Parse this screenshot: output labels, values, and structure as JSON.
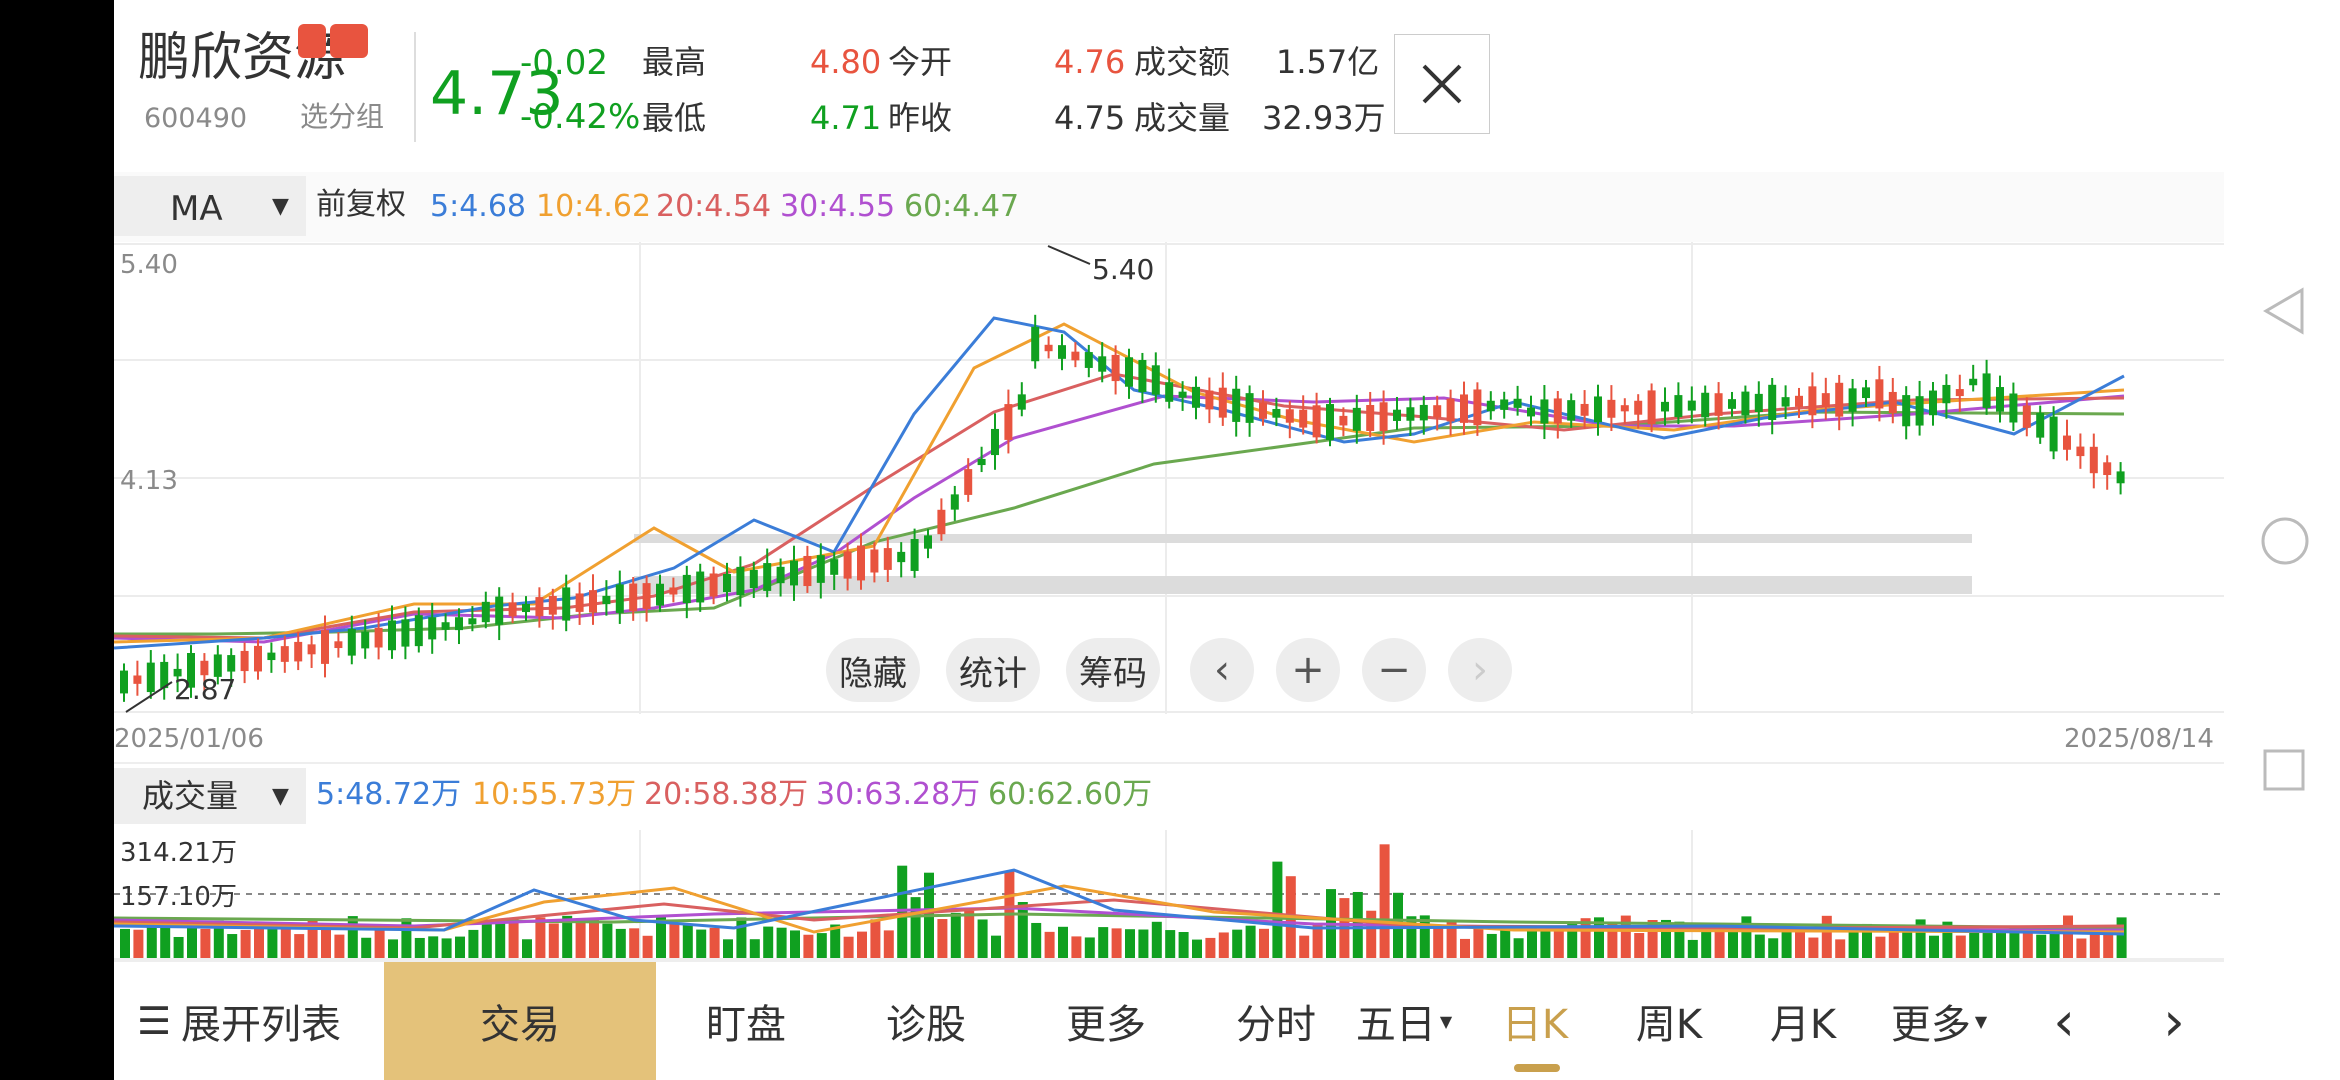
{
  "stock": {
    "name": "鹏欣资源",
    "code": "600490",
    "group": "选分组",
    "price": "4.73",
    "change": "-0.02",
    "change_pct": "-0.42%"
  },
  "quote": {
    "high_label": "最高",
    "high_value": "4.80",
    "low_label": "最低",
    "low_value": "4.71",
    "open_label": "今开",
    "open_value": "4.76",
    "prev_label": "昨收",
    "prev_value": "4.75",
    "amount_label": "成交额",
    "amount_value": "1.57亿",
    "volume_label": "成交量",
    "volume_value": "32.93万"
  },
  "ma_bar": {
    "selector": "MA",
    "adjust": "前复权",
    "ma5": "5:4.68",
    "ma10": "10:4.62",
    "ma20": "20:4.54",
    "ma30": "30:4.55",
    "ma60": "60:4.47"
  },
  "price_axis": {
    "top": "5.40",
    "mid": "4.13"
  },
  "annotations": {
    "high": "5.40",
    "low": "2.87"
  },
  "dates": {
    "start": "2025/01/06",
    "end": "2025/08/14"
  },
  "chart_buttons": {
    "hide": "隐藏",
    "stats": "统计",
    "chips": "筹码",
    "prev": "‹",
    "zoom_in": "+",
    "zoom_out": "−",
    "next": "›"
  },
  "volume_bar": {
    "selector": "成交量",
    "ma5": "5:48.72万",
    "ma10": "10:55.73万",
    "ma20": "20:58.38万",
    "ma30": "30:63.28万",
    "ma60": "60:62.60万",
    "axis_top": "314.21万",
    "axis_mid": "157.10万"
  },
  "bottom_tabs": {
    "expand": "展开列表",
    "trade": "交易",
    "watch": "盯盘",
    "diagnose": "诊股",
    "more": "更多",
    "intraday": "分时",
    "five_day": "五日",
    "daily": "日K",
    "weekly": "周K",
    "monthly": "月K",
    "more2": "更多",
    "left": "‹",
    "right": "›"
  },
  "colors": {
    "up": "#e8543f",
    "down": "#10a020",
    "ma5": "#3b7dd8",
    "ma10": "#f0a030",
    "ma20": "#d96060",
    "ma30": "#b050d0",
    "ma60": "#6aa84f",
    "trade_tab": "#e4c27a"
  },
  "chart_data": {
    "type": "candlestick",
    "x_range": [
      "2025/01/06",
      "2025/08/14"
    ],
    "price_ylim": [
      2.87,
      5.4
    ],
    "labeled_high": 5.4,
    "labeled_low": 2.87,
    "last": {
      "open": 4.76,
      "high": 4.8,
      "low": 4.71,
      "close": 4.73
    },
    "ma_latest": {
      "MA5": 4.68,
      "MA10": 4.62,
      "MA20": 4.54,
      "MA30": 4.55,
      "MA60": 4.47
    },
    "volume_ma_latest": {
      "MA5": "48.72万",
      "MA10": "55.73万",
      "MA20": "58.38万",
      "MA30": "63.28万",
      "MA60": "62.60万"
    },
    "volume_ylim_label": "314.21万"
  }
}
